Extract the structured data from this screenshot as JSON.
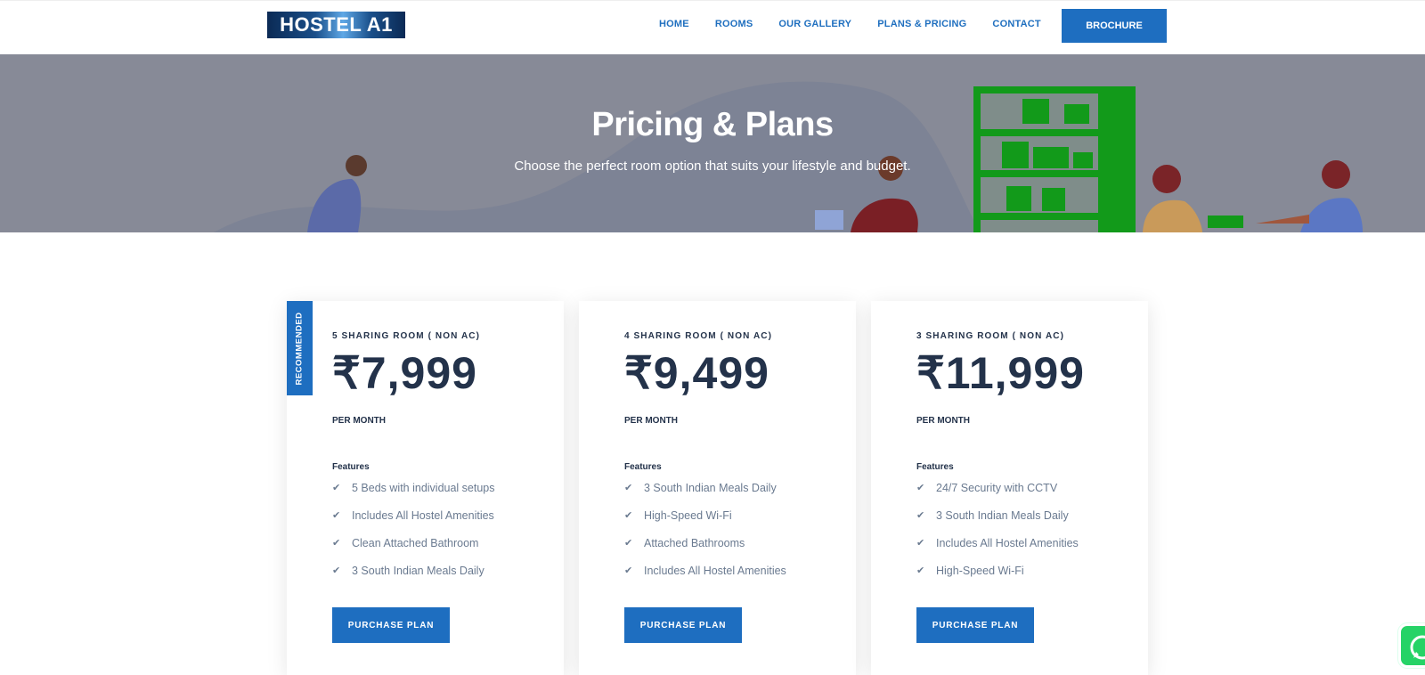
{
  "header": {
    "logo_text": "HOSTEL A1",
    "nav": [
      "HOME",
      "ROOMS",
      "OUR GALLERY",
      "PLANS & PRICING",
      "CONTACT"
    ],
    "brochure_label": "BROCHURE"
  },
  "hero": {
    "title": "Pricing & Plans",
    "subtitle": "Choose the perfect room option that suits your lifestyle and budget."
  },
  "plans": [
    {
      "ribbon": "RECOMMENDED",
      "name": "5 SHARING ROOM ( NON AC)",
      "price": "₹7,999",
      "period": "PER MONTH",
      "features_heading": "Features",
      "features": [
        "5 Beds with individual setups",
        "Includes All Hostel Amenities",
        "Clean Attached Bathroom",
        "3 South Indian Meals Daily"
      ],
      "button": "PURCHASE PLAN"
    },
    {
      "name": "4 SHARING ROOM ( NON AC)",
      "price": "₹9,499",
      "period": "PER MONTH",
      "features_heading": "Features",
      "features": [
        "3 South Indian Meals Daily",
        "High-Speed Wi-Fi",
        "Attached Bathrooms",
        "Includes All Hostel Amenities"
      ],
      "button": "PURCHASE PLAN"
    },
    {
      "name": "3 SHARING ROOM ( NON AC)",
      "price": "₹11,999",
      "period": "PER MONTH",
      "features_heading": "Features",
      "features": [
        "24/7 Security with CCTV",
        "3 South Indian Meals Daily",
        "Includes All Hostel Amenities",
        "High-Speed Wi-Fi"
      ],
      "button": "PURCHASE PLAN"
    }
  ],
  "colors": {
    "accent": "#1e6ec0",
    "text_dark": "#23324a",
    "hero_bg": "#878a97",
    "whatsapp": "#25d366"
  },
  "icons": [
    "check-icon",
    "whatsapp-icon"
  ]
}
